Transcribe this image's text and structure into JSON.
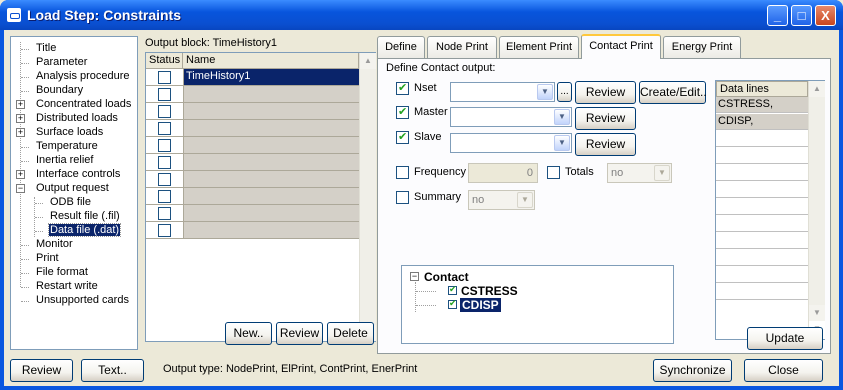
{
  "window": {
    "title": "Load Step: Constraints"
  },
  "titlebar_buttons": {
    "minimize": "_",
    "maximize": "□",
    "close": "X"
  },
  "tree": {
    "items": [
      {
        "label": "Title"
      },
      {
        "label": "Parameter"
      },
      {
        "label": "Analysis procedure"
      },
      {
        "label": "Boundary"
      },
      {
        "label": "Concentrated loads",
        "expander": "+"
      },
      {
        "label": "Distributed loads",
        "expander": "+"
      },
      {
        "label": "Surface loads",
        "expander": "+"
      },
      {
        "label": "Temperature"
      },
      {
        "label": "Inertia relief"
      },
      {
        "label": "Interface controls",
        "expander": "+"
      },
      {
        "label": "Output request",
        "expander": "−"
      },
      {
        "label": "ODB file"
      },
      {
        "label": "Result file (.fil)"
      },
      {
        "label": "Data file (.dat)",
        "selected": true
      },
      {
        "label": "Monitor"
      },
      {
        "label": "Print"
      },
      {
        "label": "File format"
      },
      {
        "label": "Restart write"
      },
      {
        "label": "Unsupported cards"
      }
    ]
  },
  "output_block": {
    "label": "Output block: TimeHistory1",
    "columns": [
      "Status",
      "Name"
    ],
    "rows": [
      {
        "name": "TimeHistory1",
        "selected": true
      },
      {
        "name": ""
      },
      {
        "name": ""
      },
      {
        "name": ""
      },
      {
        "name": ""
      },
      {
        "name": ""
      },
      {
        "name": ""
      },
      {
        "name": ""
      },
      {
        "name": ""
      },
      {
        "name": ""
      }
    ],
    "buttons": {
      "new": "New..",
      "review": "Review",
      "delete": "Delete"
    }
  },
  "tabs": [
    {
      "label": "Define"
    },
    {
      "label": "Node Print"
    },
    {
      "label": "Element Print"
    },
    {
      "label": "Contact Print",
      "active": true
    },
    {
      "label": "Energy Print"
    }
  ],
  "contact_print": {
    "section_label": "Define Contact output:",
    "nset": {
      "label": "Nset",
      "checked": true,
      "value": "",
      "browse": "...",
      "review": "Review",
      "create_edit": "Create/Edit.."
    },
    "master": {
      "label": "Master",
      "checked": true,
      "value": "",
      "review": "Review"
    },
    "slave": {
      "label": "Slave",
      "checked": true,
      "value": "",
      "review": "Review"
    },
    "frequency": {
      "label": "Frequency",
      "checked": false,
      "value": "0"
    },
    "totals": {
      "label": "Totals",
      "checked": false,
      "value": "no"
    },
    "summary": {
      "label": "Summary",
      "checked": false,
      "value": "no"
    },
    "contact_tree": {
      "root": "Contact",
      "expander": "−",
      "children": [
        {
          "label": "CSTRESS",
          "checked": true,
          "selected": false
        },
        {
          "label": "CDISP",
          "checked": true,
          "selected": true
        }
      ]
    },
    "data_lines": {
      "header": "Data lines",
      "lines": [
        "CSTRESS,",
        "CDISP,",
        "",
        "",
        "",
        "",
        "",
        "",
        "",
        "",
        "",
        ""
      ]
    },
    "update": "Update"
  },
  "footer": {
    "review": "Review",
    "text": "Text..",
    "output_type": "Output type:  NodePrint, ElPrint, ContPrint, EnerPrint",
    "synchronize": "Synchronize",
    "close": "Close"
  },
  "colors": {
    "titlebar": "#0a57e0",
    "selection": "#0a246a",
    "dialog_bg": "#ece9d8",
    "active_tab_highlight": "#ffc83c"
  }
}
